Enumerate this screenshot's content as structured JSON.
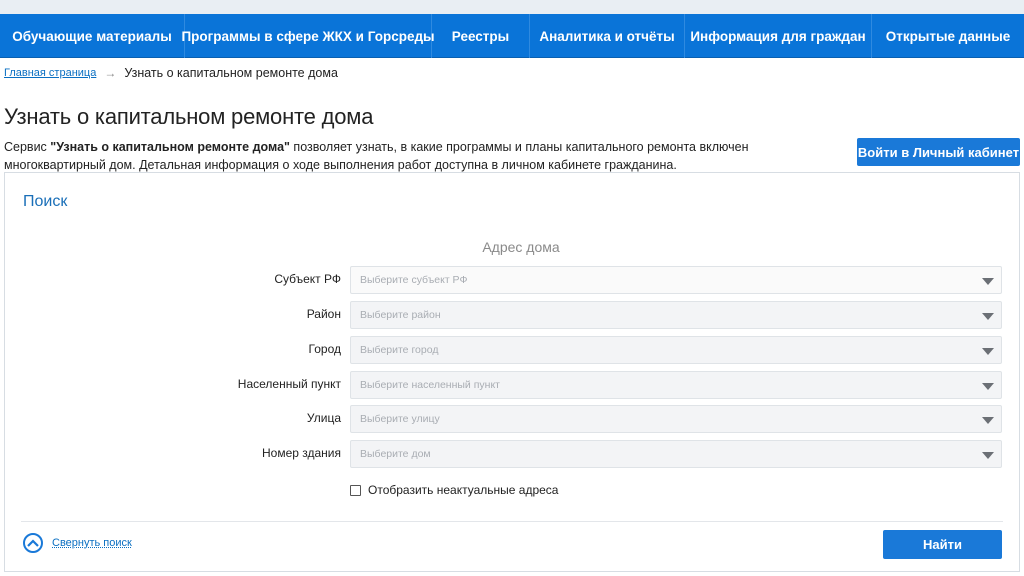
{
  "nav": {
    "items": [
      {
        "label": "Обучающие материалы"
      },
      {
        "label": "Программы в сфере ЖКХ и Горсреды"
      },
      {
        "label": "Реестры"
      },
      {
        "label": "Аналитика и отчёты"
      },
      {
        "label": "Информация для граждан"
      },
      {
        "label": "Открытые данные"
      }
    ]
  },
  "breadcrumb": {
    "home": "Главная страница",
    "arrow": "→",
    "current": "Узнать о капитальном ремонте дома"
  },
  "page": {
    "title": "Узнать о капитальном ремонте дома",
    "desc_prefix": "Сервис ",
    "desc_service": "\"Узнать о капитальном ремонте дома\"",
    "desc_rest": " позволяет узнать, в какие программы и планы капитального ремонта включен многоквартирный дом. Детальная информация о ходе выполнения работ доступна в личном кабинете гражданина.",
    "cabinet_button": "Войти в Личный кабинет"
  },
  "search": {
    "title": "Поиск",
    "address_title": "Адрес дома",
    "fields": [
      {
        "label": "Субъект РФ",
        "placeholder": "Выберите субъект РФ"
      },
      {
        "label": "Район",
        "placeholder": "Выберите район"
      },
      {
        "label": "Город",
        "placeholder": "Выберите город"
      },
      {
        "label": "Населенный пункт",
        "placeholder": "Выберите населенный пункт"
      },
      {
        "label": "Улица",
        "placeholder": "Выберите улицу"
      },
      {
        "label": "Номер здания",
        "placeholder": "Выберите дом"
      }
    ],
    "checkbox_label": "Отобразить неактуальные адреса",
    "collapse_label": "Свернуть поиск",
    "find_button": "Найти"
  },
  "colors": {
    "brand": "#0a74d8",
    "button": "#1a79d8",
    "link": "#0a6fc2"
  }
}
